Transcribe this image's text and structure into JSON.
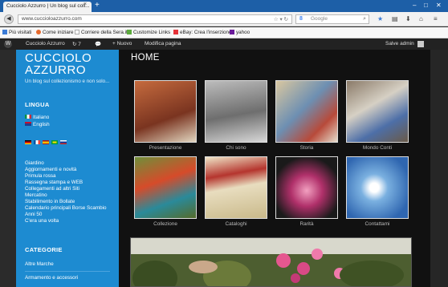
{
  "browser": {
    "tab_title": "Cucciolo Azzurro | Un blog sul coll...",
    "tab_close": "×",
    "new_tab": "+",
    "url": "www.cuccioloazzurro.com",
    "search_placeholder": "Google"
  },
  "bookmarks": [
    {
      "label": "Più visitati",
      "color": "#3b7bd6"
    },
    {
      "label": "Come iniziare",
      "color": "#e66a2c"
    },
    {
      "label": "Corriere della Sera.it",
      "color": "#ffffff"
    },
    {
      "label": "Customize Links",
      "color": "#5caa3d"
    },
    {
      "label": "eBay: Crea l'inserzione",
      "color": "#e53238"
    },
    {
      "label": "yahoo",
      "color": "#6a1b9a"
    }
  ],
  "adminbar": {
    "site_name": "Cucciolo Azzurro",
    "updates": "7",
    "new_label": "Nuovo",
    "edit_label": "Modifica pagina",
    "greeting": "Salve admin"
  },
  "site": {
    "title_line1": "CUCCIOLO",
    "title_line2": "AZZURRO",
    "tagline": "Un blog sul collezionismo e non solo..."
  },
  "language": {
    "title": "LINGUA",
    "items": [
      "Italiano",
      "English"
    ]
  },
  "menu": [
    "Giardino",
    "Aggiornamenti e novità",
    "Primula rossa",
    "Rassegna stampa e WEB",
    "Collegamenti ad altri Siti",
    "Mercatino",
    "Stabilimento in Bollate",
    "Calendario principali Borse Scambio",
    "Anni 50",
    "C'era una volta"
  ],
  "categories": {
    "title": "CATEGORIE",
    "items": [
      "Altre Marche",
      "Armamento e accessori"
    ]
  },
  "page": {
    "title": "HOME",
    "gallery": [
      {
        "caption": "Presentazione",
        "color": "#a3533a"
      },
      {
        "caption": "Chi sono",
        "color": "#8a8a8a"
      },
      {
        "caption": "Storia",
        "color": "#5f7fa0"
      },
      {
        "caption": "Mondo Conti",
        "color": "#7a6a58"
      },
      {
        "caption": "Collezione",
        "color": "#6b8a3a"
      },
      {
        "caption": "Cataloghi",
        "color": "#c9b98a"
      },
      {
        "caption": "Rarità",
        "color": "#9a3a6a"
      },
      {
        "caption": "Contattami",
        "color": "#4a78b8"
      }
    ]
  },
  "colors": {
    "sidebar": "#1d8bd1",
    "content_bg": "#111111",
    "adminbar": "#222222"
  }
}
